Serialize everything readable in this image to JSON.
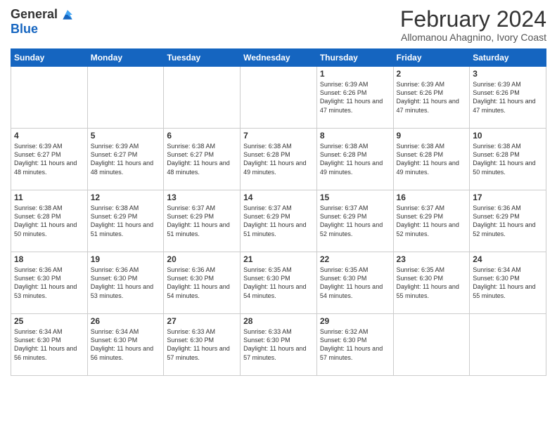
{
  "logo": {
    "general": "General",
    "blue": "Blue"
  },
  "header": {
    "month": "February 2024",
    "location": "Allomanou Ahagnino, Ivory Coast"
  },
  "weekdays": [
    "Sunday",
    "Monday",
    "Tuesday",
    "Wednesday",
    "Thursday",
    "Friday",
    "Saturday"
  ],
  "weeks": [
    [
      {
        "day": "",
        "info": ""
      },
      {
        "day": "",
        "info": ""
      },
      {
        "day": "",
        "info": ""
      },
      {
        "day": "",
        "info": ""
      },
      {
        "day": "1",
        "info": "Sunrise: 6:39 AM\nSunset: 6:26 PM\nDaylight: 11 hours and 47 minutes."
      },
      {
        "day": "2",
        "info": "Sunrise: 6:39 AM\nSunset: 6:26 PM\nDaylight: 11 hours and 47 minutes."
      },
      {
        "day": "3",
        "info": "Sunrise: 6:39 AM\nSunset: 6:26 PM\nDaylight: 11 hours and 47 minutes."
      }
    ],
    [
      {
        "day": "4",
        "info": "Sunrise: 6:39 AM\nSunset: 6:27 PM\nDaylight: 11 hours and 48 minutes."
      },
      {
        "day": "5",
        "info": "Sunrise: 6:39 AM\nSunset: 6:27 PM\nDaylight: 11 hours and 48 minutes."
      },
      {
        "day": "6",
        "info": "Sunrise: 6:38 AM\nSunset: 6:27 PM\nDaylight: 11 hours and 48 minutes."
      },
      {
        "day": "7",
        "info": "Sunrise: 6:38 AM\nSunset: 6:28 PM\nDaylight: 11 hours and 49 minutes."
      },
      {
        "day": "8",
        "info": "Sunrise: 6:38 AM\nSunset: 6:28 PM\nDaylight: 11 hours and 49 minutes."
      },
      {
        "day": "9",
        "info": "Sunrise: 6:38 AM\nSunset: 6:28 PM\nDaylight: 11 hours and 49 minutes."
      },
      {
        "day": "10",
        "info": "Sunrise: 6:38 AM\nSunset: 6:28 PM\nDaylight: 11 hours and 50 minutes."
      }
    ],
    [
      {
        "day": "11",
        "info": "Sunrise: 6:38 AM\nSunset: 6:28 PM\nDaylight: 11 hours and 50 minutes."
      },
      {
        "day": "12",
        "info": "Sunrise: 6:38 AM\nSunset: 6:29 PM\nDaylight: 11 hours and 51 minutes."
      },
      {
        "day": "13",
        "info": "Sunrise: 6:37 AM\nSunset: 6:29 PM\nDaylight: 11 hours and 51 minutes."
      },
      {
        "day": "14",
        "info": "Sunrise: 6:37 AM\nSunset: 6:29 PM\nDaylight: 11 hours and 51 minutes."
      },
      {
        "day": "15",
        "info": "Sunrise: 6:37 AM\nSunset: 6:29 PM\nDaylight: 11 hours and 52 minutes."
      },
      {
        "day": "16",
        "info": "Sunrise: 6:37 AM\nSunset: 6:29 PM\nDaylight: 11 hours and 52 minutes."
      },
      {
        "day": "17",
        "info": "Sunrise: 6:36 AM\nSunset: 6:29 PM\nDaylight: 11 hours and 52 minutes."
      }
    ],
    [
      {
        "day": "18",
        "info": "Sunrise: 6:36 AM\nSunset: 6:30 PM\nDaylight: 11 hours and 53 minutes."
      },
      {
        "day": "19",
        "info": "Sunrise: 6:36 AM\nSunset: 6:30 PM\nDaylight: 11 hours and 53 minutes."
      },
      {
        "day": "20",
        "info": "Sunrise: 6:36 AM\nSunset: 6:30 PM\nDaylight: 11 hours and 54 minutes."
      },
      {
        "day": "21",
        "info": "Sunrise: 6:35 AM\nSunset: 6:30 PM\nDaylight: 11 hours and 54 minutes."
      },
      {
        "day": "22",
        "info": "Sunrise: 6:35 AM\nSunset: 6:30 PM\nDaylight: 11 hours and 54 minutes."
      },
      {
        "day": "23",
        "info": "Sunrise: 6:35 AM\nSunset: 6:30 PM\nDaylight: 11 hours and 55 minutes."
      },
      {
        "day": "24",
        "info": "Sunrise: 6:34 AM\nSunset: 6:30 PM\nDaylight: 11 hours and 55 minutes."
      }
    ],
    [
      {
        "day": "25",
        "info": "Sunrise: 6:34 AM\nSunset: 6:30 PM\nDaylight: 11 hours and 56 minutes."
      },
      {
        "day": "26",
        "info": "Sunrise: 6:34 AM\nSunset: 6:30 PM\nDaylight: 11 hours and 56 minutes."
      },
      {
        "day": "27",
        "info": "Sunrise: 6:33 AM\nSunset: 6:30 PM\nDaylight: 11 hours and 57 minutes."
      },
      {
        "day": "28",
        "info": "Sunrise: 6:33 AM\nSunset: 6:30 PM\nDaylight: 11 hours and 57 minutes."
      },
      {
        "day": "29",
        "info": "Sunrise: 6:32 AM\nSunset: 6:30 PM\nDaylight: 11 hours and 57 minutes."
      },
      {
        "day": "",
        "info": ""
      },
      {
        "day": "",
        "info": ""
      }
    ]
  ]
}
